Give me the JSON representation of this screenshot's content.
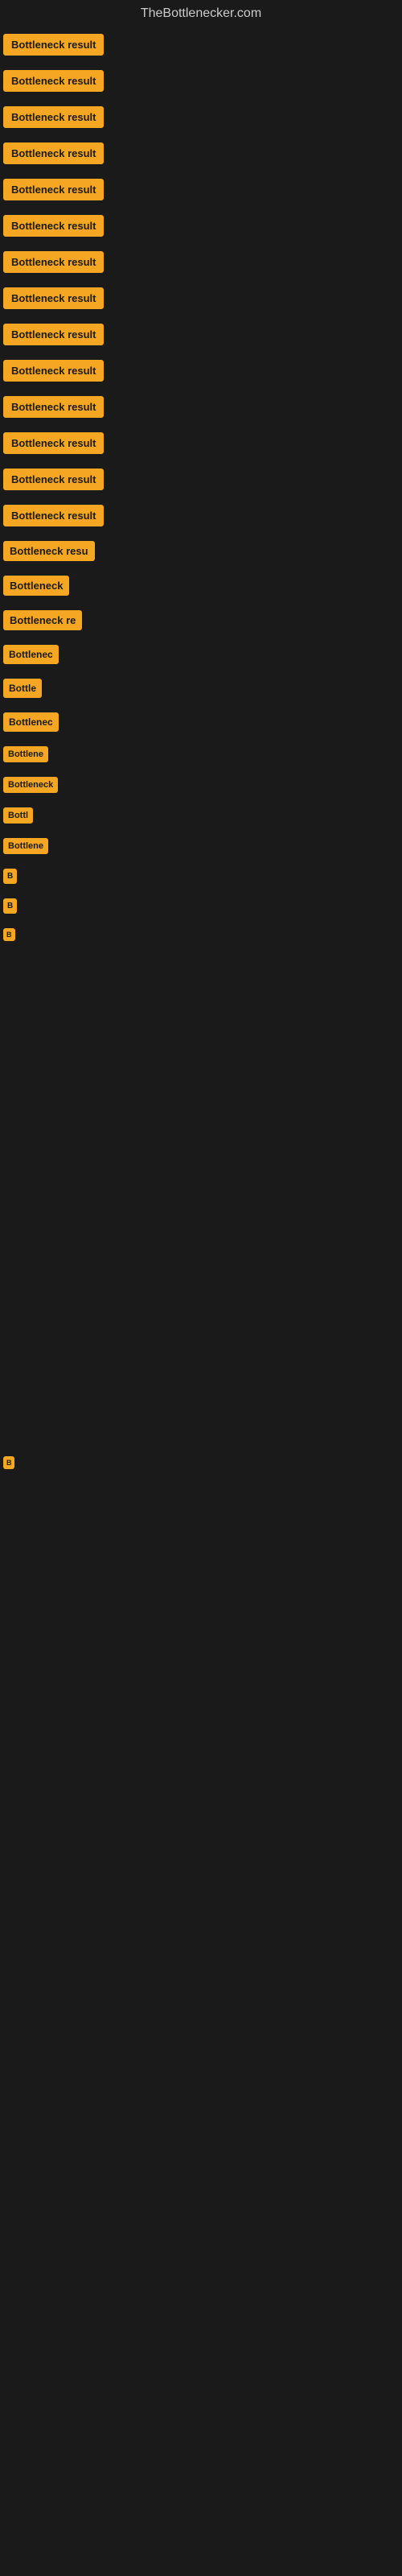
{
  "header": {
    "title": "TheBottlenecker.com"
  },
  "items": [
    {
      "id": 1,
      "label": "Bottleneck result",
      "truncated": "Bottleneck result"
    },
    {
      "id": 2,
      "label": "Bottleneck result",
      "truncated": "Bottleneck result"
    },
    {
      "id": 3,
      "label": "Bottleneck result",
      "truncated": "Bottleneck result"
    },
    {
      "id": 4,
      "label": "Bottleneck result",
      "truncated": "Bottleneck result"
    },
    {
      "id": 5,
      "label": "Bottleneck result",
      "truncated": "Bottleneck result"
    },
    {
      "id": 6,
      "label": "Bottleneck result",
      "truncated": "Bottleneck result"
    },
    {
      "id": 7,
      "label": "Bottleneck result",
      "truncated": "Bottleneck result"
    },
    {
      "id": 8,
      "label": "Bottleneck result",
      "truncated": "Bottleneck result"
    },
    {
      "id": 9,
      "label": "Bottleneck result",
      "truncated": "Bottleneck result"
    },
    {
      "id": 10,
      "label": "Bottleneck result",
      "truncated": "Bottleneck result"
    },
    {
      "id": 11,
      "label": "Bottleneck result",
      "truncated": "Bottleneck result"
    },
    {
      "id": 12,
      "label": "Bottleneck result",
      "truncated": "Bottleneck result"
    },
    {
      "id": 13,
      "label": "Bottleneck result",
      "truncated": "Bottleneck result"
    },
    {
      "id": 14,
      "label": "Bottleneck result",
      "truncated": "Bottleneck result"
    },
    {
      "id": 15,
      "label": "Bottleneck resu",
      "truncated": "Bottleneck resu"
    },
    {
      "id": 16,
      "label": "Bottleneck",
      "truncated": "Bottleneck"
    },
    {
      "id": 17,
      "label": "Bottleneck re",
      "truncated": "Bottleneck re"
    },
    {
      "id": 18,
      "label": "Bottlenec",
      "truncated": "Bottlenec"
    },
    {
      "id": 19,
      "label": "Bottle",
      "truncated": "Bottle"
    },
    {
      "id": 20,
      "label": "Bottlenec",
      "truncated": "Bottlenec"
    },
    {
      "id": 21,
      "label": "Bottlene",
      "truncated": "Bottlene"
    },
    {
      "id": 22,
      "label": "Bottleneck",
      "truncated": "Bottleneck"
    },
    {
      "id": 23,
      "label": "Bottl",
      "truncated": "Bottl"
    },
    {
      "id": 24,
      "label": "Bottlene",
      "truncated": "Bottlene"
    },
    {
      "id": 25,
      "label": "B",
      "truncated": "B"
    },
    {
      "id": 26,
      "label": "B",
      "truncated": "B"
    },
    {
      "id": 27,
      "label": "B",
      "truncated": "B"
    }
  ],
  "colors": {
    "badge_bg": "#f5a623",
    "page_bg": "#1a1a1a",
    "header_text": "#cccccc"
  }
}
